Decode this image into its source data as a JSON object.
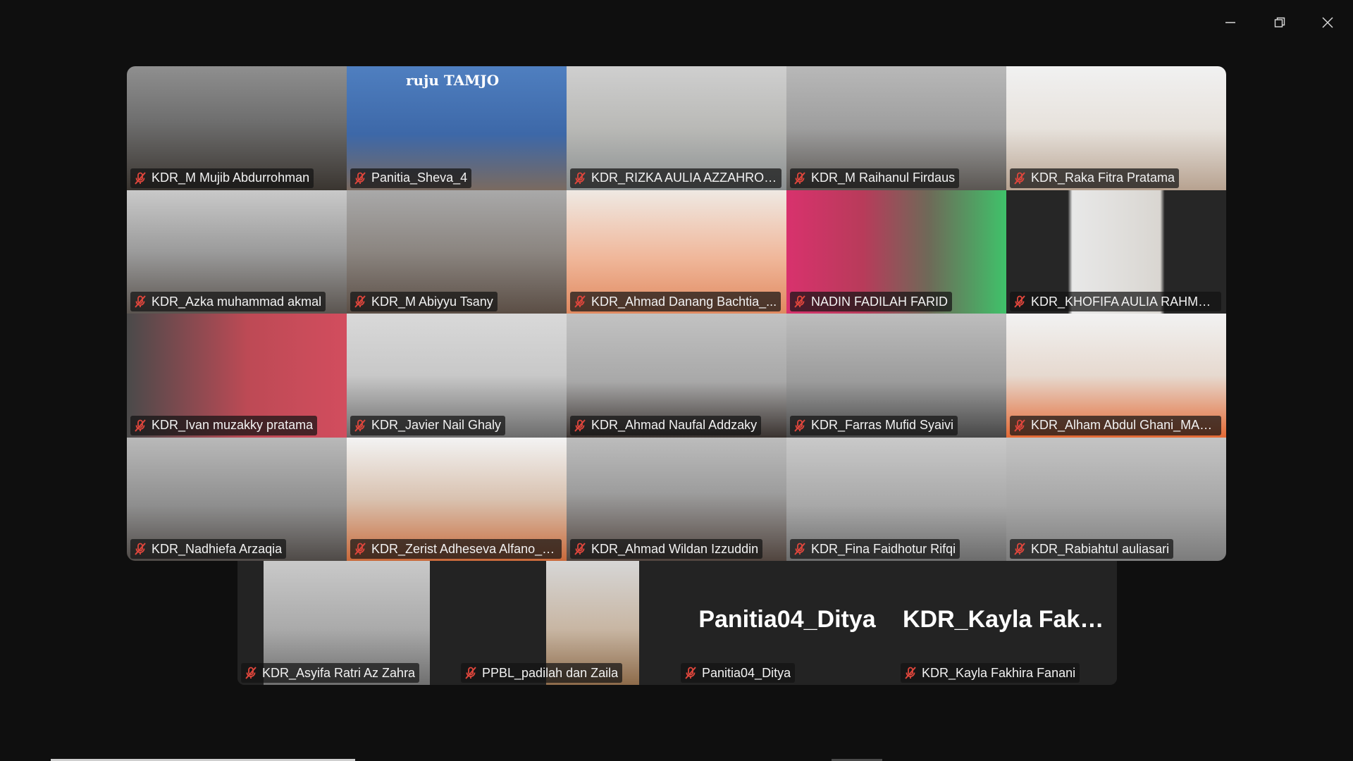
{
  "window": {
    "minimize_icon": "minimize-icon",
    "restore_icon": "restore-icon",
    "close_icon": "close-icon"
  },
  "tile_banner": {
    "text": "ruju TAMJO"
  },
  "participants": [
    {
      "name": "KDR_M Mujib Abdurrohman",
      "muted": true
    },
    {
      "name": "Panitia_Sheva_4",
      "muted": true
    },
    {
      "name": "KDR_RIZKA AULIA AZZAHROH,...",
      "muted": true
    },
    {
      "name": "KDR_M Raihanul Firdaus",
      "muted": true
    },
    {
      "name": "KDR_Raka Fitra Pratama",
      "muted": true
    },
    {
      "name": "KDR_Azka muhammad akmal",
      "muted": true
    },
    {
      "name": "KDR_M Abiyyu Tsany",
      "muted": true
    },
    {
      "name": "KDR_Ahmad Danang Bachtia_...",
      "muted": true,
      "active_speaker": true
    },
    {
      "name": "NADIN FADILAH FARID",
      "muted": true
    },
    {
      "name": "KDR_KHOFIFA AULIA RAHMAW...",
      "muted": true
    },
    {
      "name": "KDR_Ivan muzakky pratama",
      "muted": true
    },
    {
      "name": "KDR_Javier Nail Ghaly",
      "muted": true
    },
    {
      "name": "KDR_Ahmad Naufal Addzaky",
      "muted": true
    },
    {
      "name": "KDR_Farras Mufid Syaivi",
      "muted": true
    },
    {
      "name": "KDR_Alham Abdul Ghani_MAN ...",
      "muted": true
    },
    {
      "name": "KDR_Nadhiefa Arzaqia",
      "muted": true
    },
    {
      "name": "KDR_Zerist Adheseva Alfano_M...",
      "muted": true
    },
    {
      "name": "KDR_Ahmad Wildan Izzuddin",
      "muted": true
    },
    {
      "name": "KDR_Fina Faidhotur Rifqi",
      "muted": true
    },
    {
      "name": "KDR_Rabiahtul auliasari",
      "muted": true
    },
    {
      "name": "KDR_Asyifa Ratri Az Zahra",
      "muted": true
    },
    {
      "name": "PPBL_padilah dan Zaila",
      "muted": true
    },
    {
      "name": "Panitia04_Ditya",
      "muted": true,
      "video_off": true,
      "display": "Panitia04_Ditya"
    },
    {
      "name": "KDR_Kayla Fakhira Fanani",
      "muted": true,
      "video_off": true,
      "display": "KDR_Kayla  Fakh..."
    }
  ],
  "colors": {
    "background": "#0f0f0f",
    "tile_off": "#232323",
    "active_border": "#2dd36f",
    "mic_muted": "#e0463c"
  }
}
